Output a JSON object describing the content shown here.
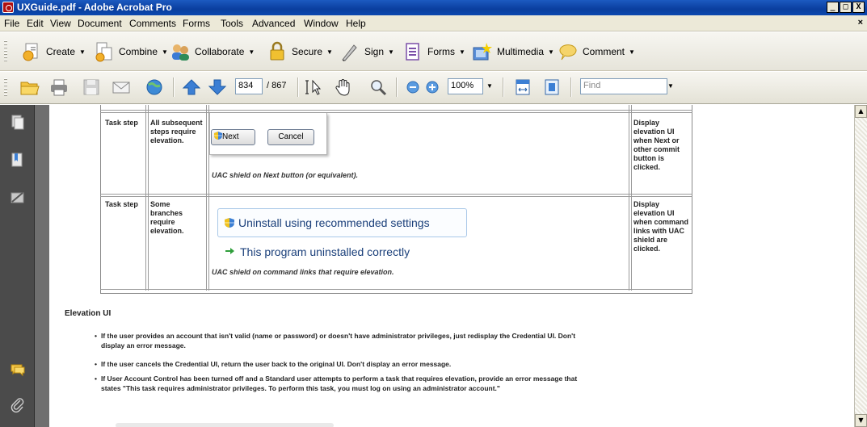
{
  "window": {
    "title": "UXGuide.pdf - Adobe Acrobat Pro",
    "controls": [
      "_",
      "□",
      "X"
    ],
    "doc_close": "×"
  },
  "menu": [
    "File",
    "Edit",
    "View",
    "Document",
    "Comments",
    "Forms",
    "Tools",
    "Advanced",
    "Window",
    "Help"
  ],
  "task_toolbar": [
    {
      "label": "Create",
      "icon": "create-icon"
    },
    {
      "label": "Combine",
      "icon": "combine-icon"
    },
    {
      "label": "Collaborate",
      "icon": "collaborate-icon"
    },
    {
      "label": "Secure",
      "icon": "lock-icon"
    },
    {
      "label": "Sign",
      "icon": "pen-icon"
    },
    {
      "label": "Forms",
      "icon": "forms-icon"
    },
    {
      "label": "Multimedia",
      "icon": "multimedia-icon"
    },
    {
      "label": "Comment",
      "icon": "comment-icon"
    }
  ],
  "nav_toolbar": {
    "current_page": "834",
    "total_pages": "/ 867",
    "zoom": "100%",
    "find_placeholder": "Find"
  },
  "table": {
    "rows": [
      {
        "type": "Task step",
        "condition": "All subsequent steps require elevation.",
        "buttons": [
          "Next",
          "Cancel"
        ],
        "caption": "UAC shield on Next button (or equivalent).",
        "result": "Display elevation UI when Next or other commit button is clicked."
      },
      {
        "type": "Task step",
        "condition": "Some branches require elevation.",
        "command_links": [
          "Uninstall using recommended settings",
          "This program uninstalled correctly"
        ],
        "caption": "UAC shield on command links that require elevation.",
        "result": "Display elevation UI when command links with UAC shield are clicked."
      }
    ]
  },
  "section": {
    "title": "Elevation UI",
    "bullets": [
      "If the user provides an account that isn't valid (name or password) or doesn't have administrator privileges, just redisplay the Credential UI. Don't display an error message.",
      "If the user cancels the Credential UI, return the user back to the original UI. Don't display an error message.",
      "If User Account Control has been turned off and a Standard user attempts to perform a task that requires elevation, provide an error message that states \"This task requires administrator privileges. To perform this task, you must log on using an administrator account.\""
    ]
  },
  "colors": {
    "titlebar": "#0a3e9e",
    "navpane": "#4b4b4b",
    "link_text": "#1a3f7a"
  }
}
